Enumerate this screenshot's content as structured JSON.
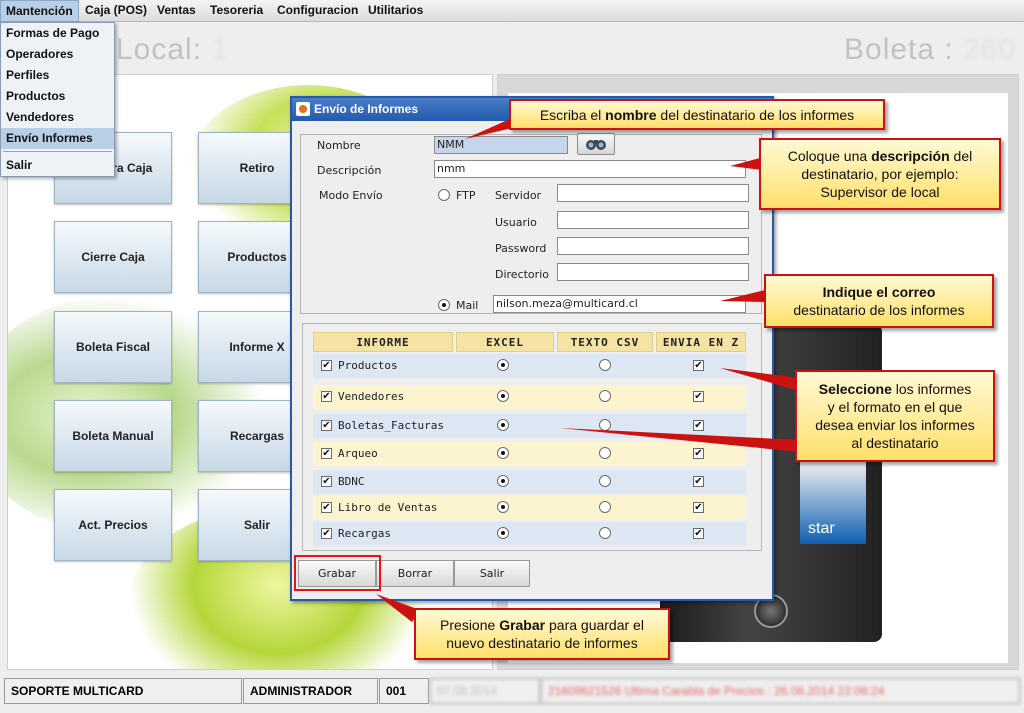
{
  "menu": {
    "items": [
      "Mantención",
      "Caja (POS)",
      "Ventas",
      "Tesoreria",
      "Configuracion",
      "Utilitarios"
    ],
    "dropdown": [
      "Formas de Pago",
      "Operadores",
      "Perfiles",
      "Productos",
      "Vendedores",
      "Envío Informes",
      "Salir"
    ]
  },
  "header": {
    "local_label": "Local:",
    "local_value": "1",
    "boleta_label": "Boleta :",
    "boleta_value": "260"
  },
  "tiles": [
    "Apertura Caja",
    "Retiro",
    "Cierre Caja",
    "Productos",
    "Boleta Fiscal",
    "Informe X",
    "Boleta Manual",
    "Recargas",
    "Act. Precios",
    "Salir"
  ],
  "dialog": {
    "title": "Envío de Informes",
    "nombre_label": "Nombre",
    "nombre_value": "NMM",
    "descripcion_label": "Descripción",
    "descripcion_value": "nmm",
    "modo_envio_label": "Modo Envío",
    "ftp_label": "FTP",
    "servidor_label": "Servidor",
    "usuario_label": "Usuario",
    "password_label": "Password",
    "directorio_label": "Directorio",
    "mail_label": "Mail",
    "mail_value": "nilson.meza@multicard.cl",
    "grid_headers": [
      "INFORME",
      "EXCEL",
      "TEXTO CSV",
      "ENVIA EN Z"
    ],
    "grid_rows": [
      "Productos",
      "Vendedores",
      "Boletas_Facturas",
      "Arqueo",
      "BDNC",
      "Libro de Ventas",
      "Recargas"
    ],
    "buttons": [
      "Grabar",
      "Borrar",
      "Salir"
    ]
  },
  "callouts": {
    "nombre": [
      "Escriba el ",
      "nombre",
      " del destinatario de los informes"
    ],
    "descripcion": [
      "Coloque una ",
      "descripción",
      " del destinatario, por ejemplo:",
      "Supervisor de local"
    ],
    "correo": [
      "Indique el correo",
      "destinatario de los informes"
    ],
    "seleccione": [
      "Seleccione",
      " los informes",
      "y el formato en el que",
      "desea enviar los informes",
      "al destinatario"
    ],
    "grabar": [
      "Presione ",
      "Grabar",
      " para guardar el",
      "nuevo destinatario de informes"
    ]
  },
  "status": {
    "company": "SOPORTE MULTICARD",
    "user": "ADMINISTRADOR",
    "terminal": "001",
    "date": "07.08.2014",
    "message": "21609621526 Ultima Carabla de Precios : 26.06.2014 22:06:24"
  },
  "phone_brand": "star",
  "colors": {
    "title_bar": "#245aad",
    "callout_border": "#cc1111",
    "callout_bg": "#ffe06a",
    "grid_header": "#f5e3a4"
  }
}
